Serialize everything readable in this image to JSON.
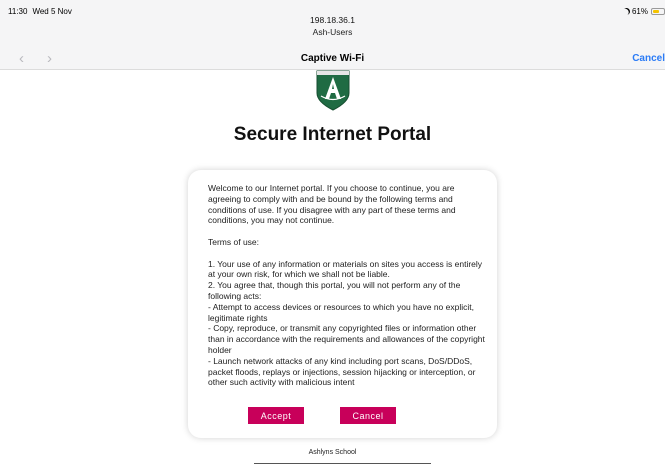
{
  "status_bar": {
    "time": "11:30",
    "date": "Wed 5 Nov",
    "battery": "61%",
    "battery_level": 0.61,
    "battery_color": "#f5c400"
  },
  "address": {
    "ip": "198.18.36.1",
    "network": "Ash-Users"
  },
  "nav": {
    "back_icon": "chevron-left-icon",
    "forward_icon": "chevron-right-icon",
    "title": "Captive Wi-Fi",
    "cancel_label": "Cancel",
    "cancel_color": "#2a7bf6"
  },
  "portal": {
    "title": "Secure Internet Portal",
    "intro": "Welcome to our Internet portal. If you choose to continue, you are agreeing to comply with and be bound by the following terms and conditions of use. If you disagree with any part of these terms and conditions, you may not continue.",
    "terms_heading": "Terms of use:",
    "terms": [
      "1. Your use of any information or materials on sites you access is entirely at your own risk, for which we shall not be liable.",
      "2. You agree that, though this portal, you will not perform any of the following acts:",
      "- Attempt to access devices or resources to which you have no explicit, legitimate rights",
      "- Copy, reproduce, or transmit any copyrighted files or information other than in accordance with the requirements and allowances of the copyright holder",
      "- Launch network attacks of any kind including port scans, DoS/DDoS, packet floods, replays or injections, session hijacking or interception, or other such activity with malicious intent"
    ],
    "accept_label": "Accept",
    "cancel_label": "Cancel",
    "button_color": "#c8005a"
  },
  "footer": {
    "school": "Ashlyns School"
  }
}
